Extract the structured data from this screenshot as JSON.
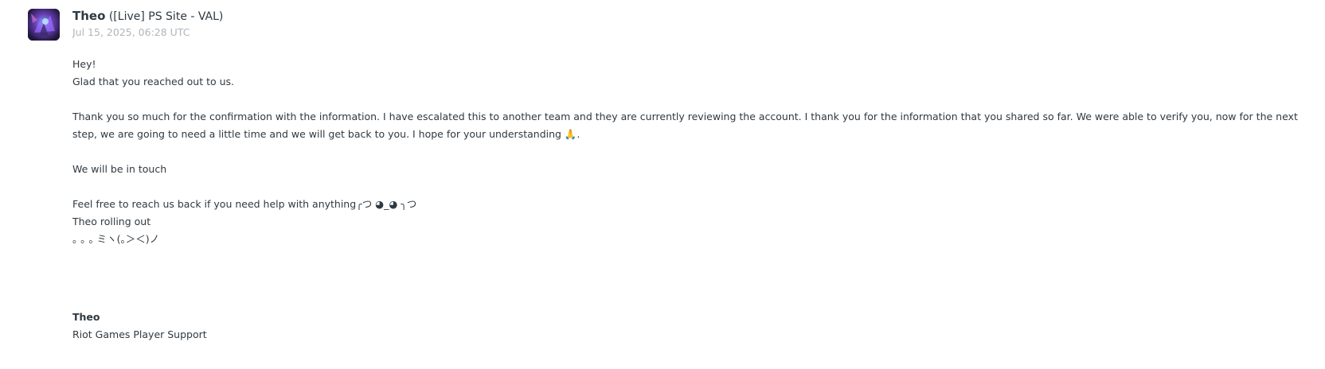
{
  "comment": {
    "author": {
      "name": "Theo",
      "org": "([Live] PS Site - VAL)",
      "avatar_icon": "avatar-image"
    },
    "timestamp": "Jul 15, 2025, 06:28 UTC",
    "body": {
      "greeting": "Hey!",
      "line2": "Glad that you reached out to us.",
      "paragraph": "Thank you so much for the confirmation with the information. I have escalated this to another team and they are currently reviewing the account. I thank you for the information that you shared so far. We were able to verify you, now for the next step, we are going to need a little time and we will get back to you. I hope for your understanding 🙏.",
      "in_touch": "We will be in touch",
      "feel_free": "Feel free to reach us back if you need help with anything╭つ ◕_◕ ╮つ",
      "rolling_out": "Theo rolling out",
      "kaomoji": "｡ ｡ ｡ ミヽ(｡＞＜)ノ"
    },
    "signature": {
      "name": "Theo",
      "title": "Riot Games Player Support"
    }
  },
  "colors": {
    "text": "#2f3941",
    "muted": "#b0b6bb",
    "background": "#ffffff"
  }
}
